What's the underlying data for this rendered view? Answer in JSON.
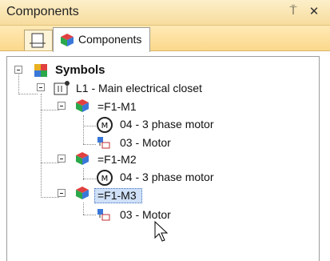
{
  "panel": {
    "title": "Components",
    "pin_glyph": "⍑",
    "close_glyph": "✕"
  },
  "tabs": [
    {
      "label": "",
      "icon": "file-tree-icon"
    },
    {
      "label": "Components",
      "icon": "components-icon",
      "active": true
    }
  ],
  "tree": {
    "root": "Symbols",
    "location": "L1 - Main electrical closet",
    "components": [
      {
        "name": "=F1-M1",
        "children": [
          "04 - 3 phase motor",
          "03 - Motor"
        ]
      },
      {
        "name": "=F1-M2",
        "children": [
          "04 - 3 phase motor"
        ]
      },
      {
        "name": "=F1-M3",
        "selected": true,
        "children": [
          "03 - Motor"
        ]
      }
    ]
  }
}
